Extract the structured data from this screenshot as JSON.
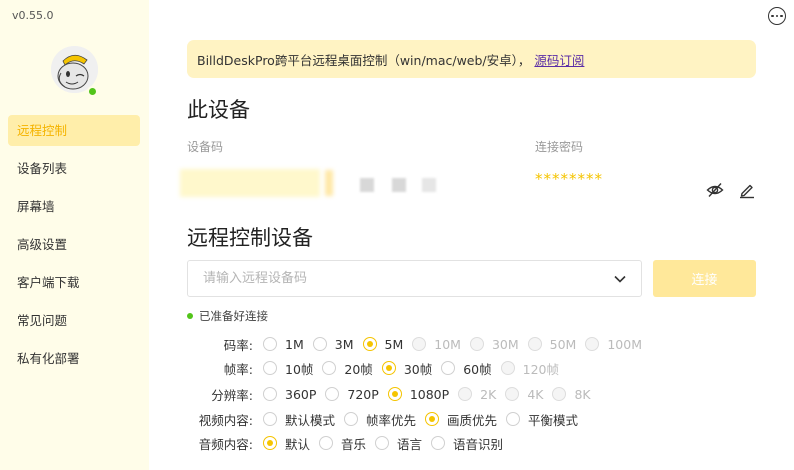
{
  "app": {
    "version": "v0.55.0"
  },
  "sidebar": {
    "items": [
      {
        "label": "远程控制",
        "active": true
      },
      {
        "label": "设备列表"
      },
      {
        "label": "屏幕墙"
      },
      {
        "label": "高级设置"
      },
      {
        "label": "客户端下载"
      },
      {
        "label": "常见问题"
      },
      {
        "label": "私有化部署"
      }
    ]
  },
  "notice": {
    "text": "BilldDeskPro跨平台远程桌面控制（win/mac/web/安卓），",
    "link": "源码订阅"
  },
  "device": {
    "title": "此设备",
    "code_label": "设备码",
    "password_label": "连接密码",
    "password_value": "********"
  },
  "remote": {
    "title": "远程控制设备",
    "input_placeholder": "请输入远程设备码",
    "connect_label": "连接",
    "status_text": "已准备好连接"
  },
  "settings": {
    "bitrate": {
      "label": "码率:",
      "options": [
        "1M",
        "3M",
        "5M",
        "10M",
        "30M",
        "50M",
        "100M"
      ],
      "selected": "5M",
      "disabled": [
        "10M",
        "30M",
        "50M",
        "100M"
      ]
    },
    "framerate": {
      "label": "帧率:",
      "options": [
        "10帧",
        "20帧",
        "30帧",
        "60帧",
        "120帧"
      ],
      "selected": "30帧",
      "disabled": [
        "120帧"
      ]
    },
    "resolution": {
      "label": "分辨率:",
      "options": [
        "360P",
        "720P",
        "1080P",
        "2K",
        "4K",
        "8K"
      ],
      "selected": "1080P",
      "disabled": [
        "2K",
        "4K",
        "8K"
      ]
    },
    "video_content": {
      "label": "视频内容:",
      "options": [
        "默认模式",
        "帧率优先",
        "画质优先",
        "平衡模式"
      ],
      "selected": "画质优先",
      "disabled": []
    },
    "audio_content": {
      "label": "音频内容:",
      "options": [
        "默认",
        "音乐",
        "语言",
        "语音识别"
      ],
      "selected": "默认",
      "disabled": []
    }
  },
  "colors": {
    "accent": "#f5c400",
    "sidebar_bg": "#fffde9",
    "notice_bg": "#fff3c3",
    "online": "#52c41a",
    "link": "#5b2ea6"
  },
  "icons": {
    "more": "more-icon",
    "visibility": "eye-off-icon",
    "edit": "edit-icon",
    "dropdown": "chevron-down-icon"
  }
}
